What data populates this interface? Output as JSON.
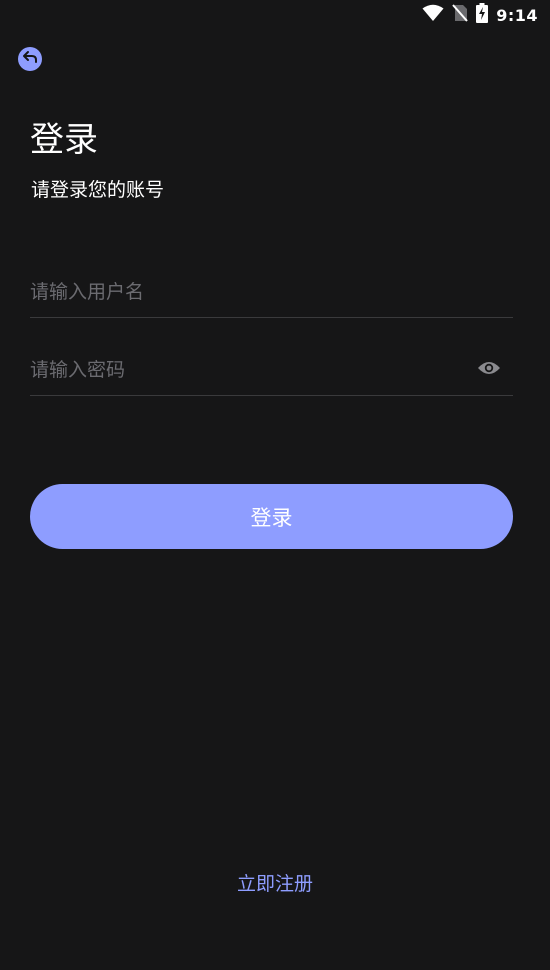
{
  "status_bar": {
    "time": "9:14",
    "icons": [
      "wifi-icon",
      "no-sim-icon",
      "battery-charging-icon"
    ]
  },
  "header": {
    "back_icon": "back-arrow-icon"
  },
  "login": {
    "title": "登录",
    "subtitle": "请登录您的账号",
    "username": {
      "value": "",
      "placeholder": "请输入用户名"
    },
    "password": {
      "value": "",
      "placeholder": "请输入密码",
      "toggle_icon": "eye-icon"
    },
    "submit_label": "登录",
    "register_label": "立即注册"
  },
  "colors": {
    "background": "#161617",
    "accent": "#8e9dff",
    "divider": "#3a3a3c",
    "placeholder": "#6b6b70",
    "text": "#ffffff"
  }
}
